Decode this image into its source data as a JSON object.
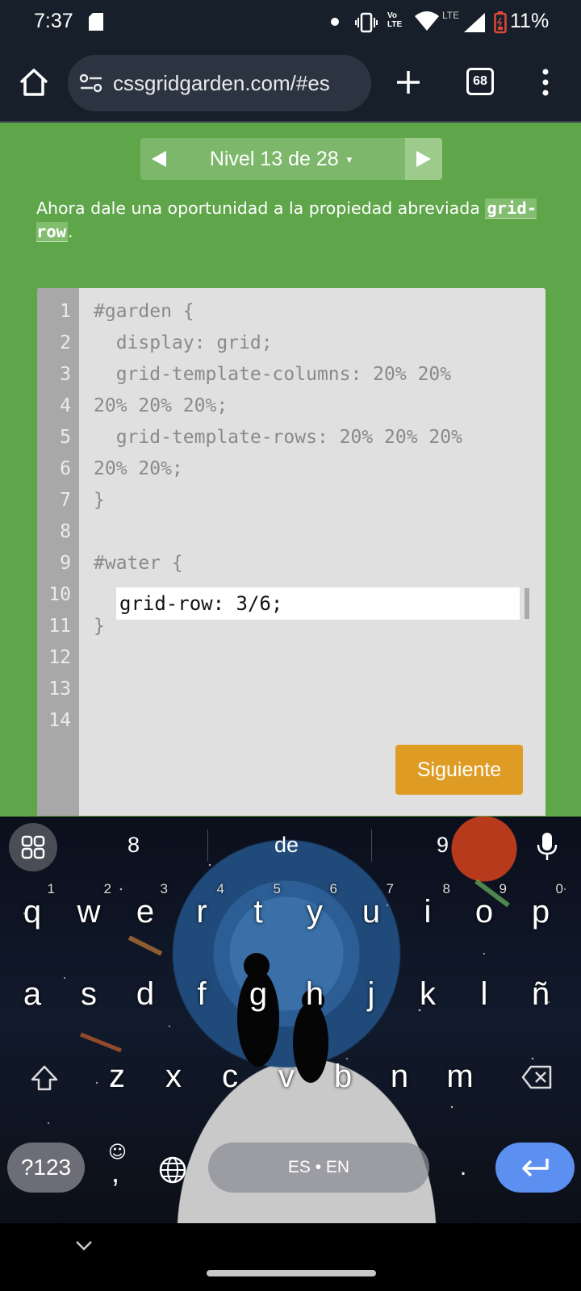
{
  "status_bar": {
    "time": "7:37",
    "network_label": "LTE",
    "volte_label_1": "Vo",
    "volte_label_2": "LTE",
    "battery_pct": "11%",
    "battery_color": "#e0463a"
  },
  "browser": {
    "url": "cssgridgarden.com/#es",
    "tab_count": "68"
  },
  "level_nav": {
    "label": "Nivel 13 de 28",
    "caret": "▾"
  },
  "instructions": {
    "prefix": "Ahora dale una oportunidad a la propiedad abreviada ",
    "code": "grid-row",
    "suffix": "."
  },
  "editor": {
    "line_numbers": [
      "1",
      "2",
      "3",
      "4",
      "5",
      "6",
      "7",
      "8",
      "9",
      "10",
      "11",
      "12",
      "13",
      "14"
    ],
    "lines": [
      "#garden {",
      "  display: grid;",
      "  grid-template-columns: 20% 20%",
      "20% 20% 20%;",
      "  grid-template-rows: 20% 20% 20%",
      "20% 20%;",
      "}",
      "",
      "#water {",
      "",
      "}"
    ],
    "answer_value": "grid-row: 3/6;",
    "next_button": "Siguiente",
    "accent_color": "#de9c25"
  },
  "keyboard": {
    "suggestions": [
      "8",
      "de",
      "9"
    ],
    "row1": [
      {
        "char": "q",
        "hint": "1"
      },
      {
        "char": "w",
        "hint": "2"
      },
      {
        "char": "e",
        "hint": "3"
      },
      {
        "char": "r",
        "hint": "4"
      },
      {
        "char": "t",
        "hint": "5"
      },
      {
        "char": "y",
        "hint": "6"
      },
      {
        "char": "u",
        "hint": "7"
      },
      {
        "char": "i",
        "hint": "8"
      },
      {
        "char": "o",
        "hint": "9"
      },
      {
        "char": "p",
        "hint": "0"
      }
    ],
    "row2": [
      "a",
      "s",
      "d",
      "f",
      "g",
      "h",
      "j",
      "k",
      "l",
      "ñ"
    ],
    "row3": [
      "z",
      "x",
      "c",
      "v",
      "b",
      "n",
      "m"
    ],
    "symbols": "?123",
    "comma": ",",
    "emoji_glyph": "☺",
    "space_label": "ES • EN",
    "period": ".",
    "enter_color": "#5b8ff0"
  },
  "colors": {
    "page_bg": "#5fa54a",
    "chrome_bg": "#17202a"
  }
}
